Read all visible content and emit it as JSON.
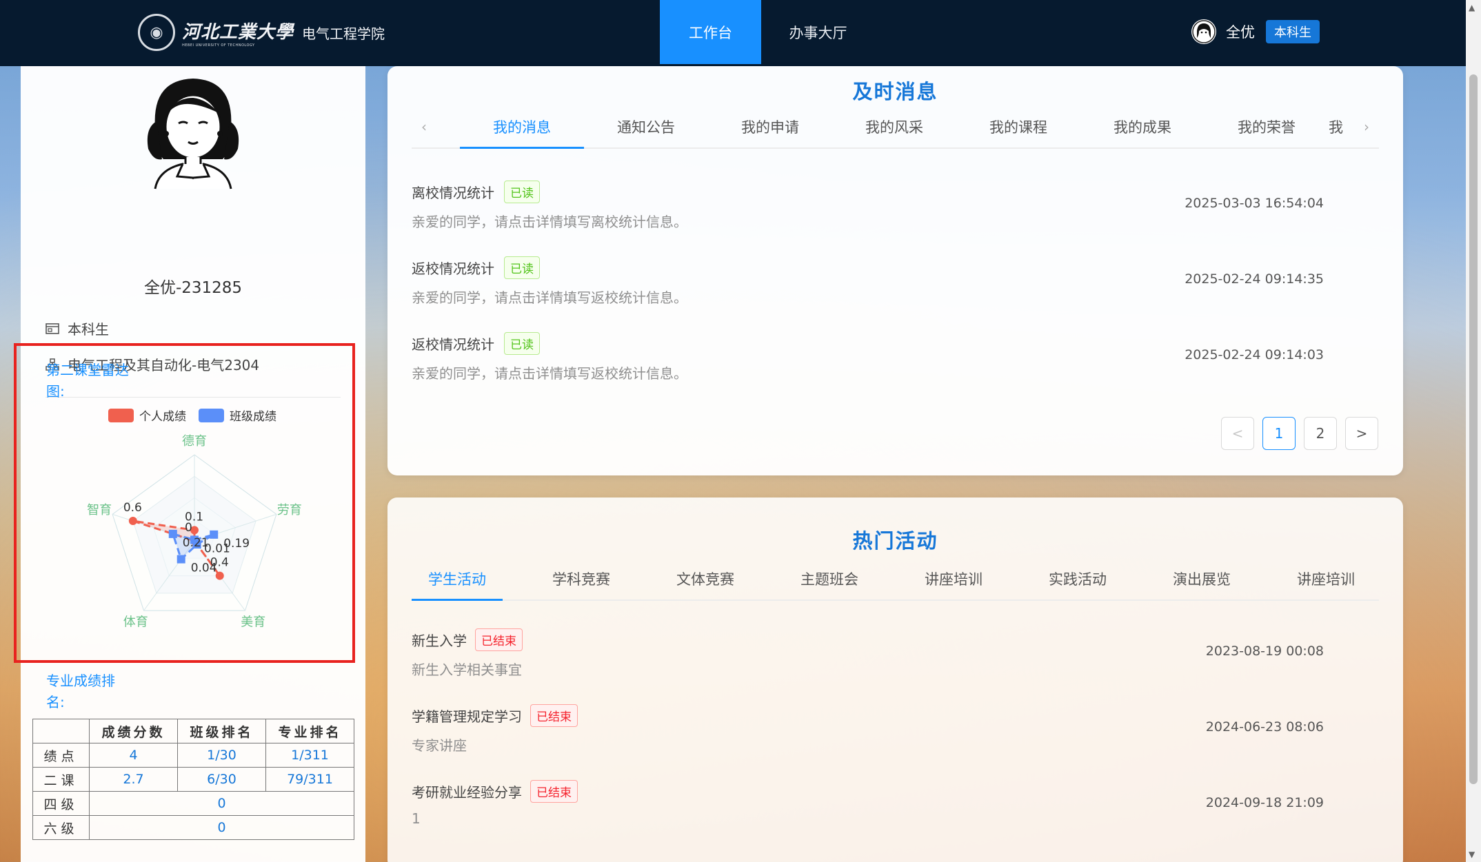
{
  "header": {
    "university_name": "河北工業大學",
    "university_en": "HEBEI UNIVERSITY OF TECHNOLOGY",
    "college": "电气工程学院",
    "nav": [
      {
        "label": "工作台",
        "active": true
      },
      {
        "label": "办事大厅",
        "active": false
      }
    ],
    "user_name": "全优",
    "user_badge": "本科生"
  },
  "profile": {
    "name": "全优-231285",
    "role": "本科生",
    "major_class": "电气工程及其自动化-电气2304"
  },
  "radar": {
    "title": "第二课堂雷达图:",
    "legend": [
      "个人成绩",
      "班级成绩"
    ],
    "colors": {
      "personal": "#f0604e",
      "class": "#5b8ff9"
    },
    "axes": [
      "德育",
      "劳育",
      "美育",
      "体育",
      "智育"
    ],
    "personal": {
      "values": [
        0.1,
        0,
        0.4,
        0,
        0.6
      ],
      "labels": [
        "0.1",
        "0",
        "0.4",
        "",
        "0.6"
      ]
    },
    "class": {
      "values": [
        0.01,
        0.19,
        0.04,
        0.21,
        0.21
      ],
      "labels": [
        "0.01",
        "0.19",
        "",
        "0.04",
        "0.21"
      ]
    }
  },
  "ranking": {
    "title": "专业成绩排名:",
    "columns": [
      "",
      "成绩分数",
      "班级排名",
      "专业排名"
    ],
    "rows": [
      {
        "label": "绩点",
        "score": "4",
        "class_rank": "1/30",
        "major_rank": "1/311"
      },
      {
        "label": "二课",
        "score": "2.7",
        "class_rank": "6/30",
        "major_rank": "79/311"
      },
      {
        "label": "四级",
        "value": "0"
      },
      {
        "label": "六级",
        "value": "0"
      }
    ]
  },
  "messages": {
    "title": "及时消息",
    "tabs": [
      "我的消息",
      "通知公告",
      "我的申请",
      "我的风采",
      "我的课程",
      "我的成果",
      "我的荣誉",
      "我"
    ],
    "items": [
      {
        "title": "离校情况统计",
        "tag": "已读",
        "desc": "亲爱的同学，请点击详情填写离校统计信息。",
        "time": "2025-03-03 16:54:04"
      },
      {
        "title": "返校情况统计",
        "tag": "已读",
        "desc": "亲爱的同学，请点击详情填写返校统计信息。",
        "time": "2025-02-24 09:14:35"
      },
      {
        "title": "返校情况统计",
        "tag": "已读",
        "desc": "亲爱的同学，请点击详情填写返校统计信息。",
        "time": "2025-02-24 09:14:03"
      }
    ],
    "pager": {
      "prev": "<",
      "pages": [
        "1",
        "2"
      ],
      "current": "1",
      "next": ">"
    }
  },
  "activities": {
    "title": "热门活动",
    "tabs": [
      "学生活动",
      "学科竞赛",
      "文体竞赛",
      "主题班会",
      "讲座培训",
      "实践活动",
      "演出展览",
      "讲座培训"
    ],
    "items": [
      {
        "title": "新生入学",
        "tag": "已结束",
        "desc": "新生入学相关事宜",
        "time": "2023-08-19 00:08"
      },
      {
        "title": "学籍管理规定学习",
        "tag": "已结束",
        "desc": "专家讲座",
        "time": "2024-06-23 08:06"
      },
      {
        "title": "考研就业经验分享",
        "tag": "已结束",
        "desc": "1",
        "time": "2024-09-18 21:09"
      }
    ]
  }
}
